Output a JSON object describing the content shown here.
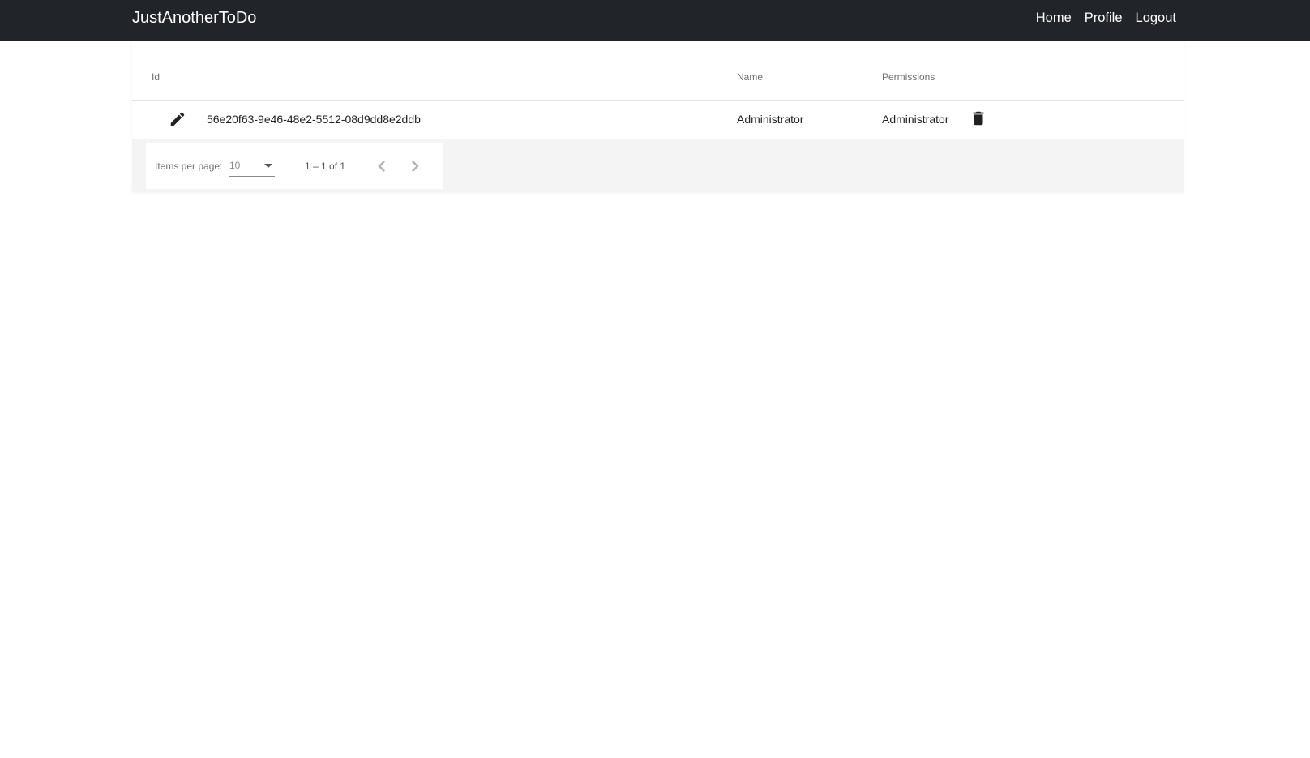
{
  "app": {
    "brand": "JustAnotherToDo",
    "nav": [
      {
        "label": "Home"
      },
      {
        "label": "Profile"
      },
      {
        "label": "Logout"
      }
    ]
  },
  "table": {
    "columns": {
      "id": "Id",
      "name": "Name",
      "permissions": "Permissions"
    },
    "rows": [
      {
        "id": "56e20f63-9e46-48e2-5512-08d9dd8e2ddb",
        "name": "Administrator",
        "permissions": "Administrator",
        "edit_icon": "pencil-icon",
        "delete_icon": "trash-icon"
      }
    ]
  },
  "paginator": {
    "items_per_page_label": "Items per page:",
    "items_per_page_value": "10",
    "range_label": "1 – 1 of 1",
    "prev_icon": "chevron-left-icon",
    "next_icon": "chevron-right-icon"
  }
}
